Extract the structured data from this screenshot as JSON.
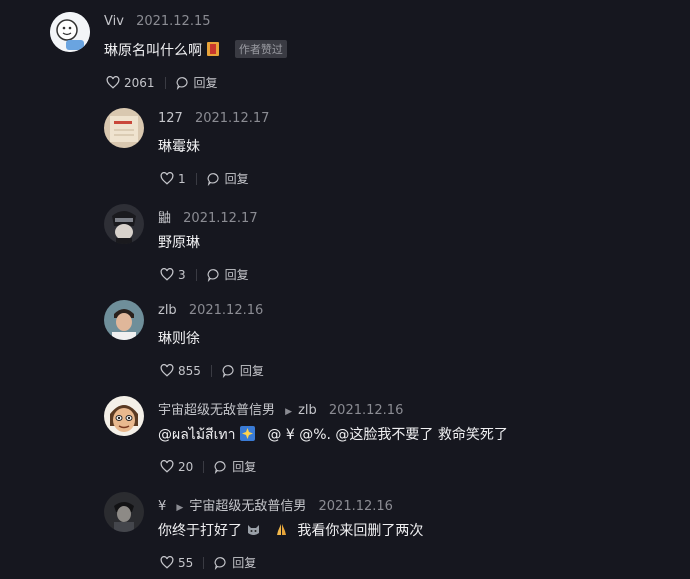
{
  "comments": [
    {
      "author": "Viv",
      "date": "2021.12.15",
      "text": "琳原名叫什么啊",
      "badge": "作者赞过",
      "likes": "2061",
      "reply_label": "回复"
    },
    {
      "author": "127",
      "date": "2021.12.17",
      "text": "琳霉妹",
      "likes": "1",
      "reply_label": "回复"
    },
    {
      "author": "鼬",
      "date": "2021.12.17",
      "text": "野原琳",
      "likes": "3",
      "reply_label": "回复"
    },
    {
      "author": "zlb",
      "date": "2021.12.16",
      "text": "琳则徐",
      "likes": "855",
      "reply_label": "回复"
    },
    {
      "author": "宇宙超级无敌普信男",
      "reply_to": "zlb",
      "date": "2021.12.16",
      "text_a": "@ผลไม้สีเทา",
      "text_b": "@ ¥   @%.  @这脸我不要了 救命笑死了",
      "likes": "20",
      "reply_label": "回复"
    },
    {
      "author": "¥",
      "reply_to": "宇宙超级无敌普信男",
      "date": "2021.12.16",
      "text_a": "你终于打好了",
      "text_b": "我看你来回删了两次",
      "likes": "55",
      "reply_label": "回复"
    }
  ]
}
